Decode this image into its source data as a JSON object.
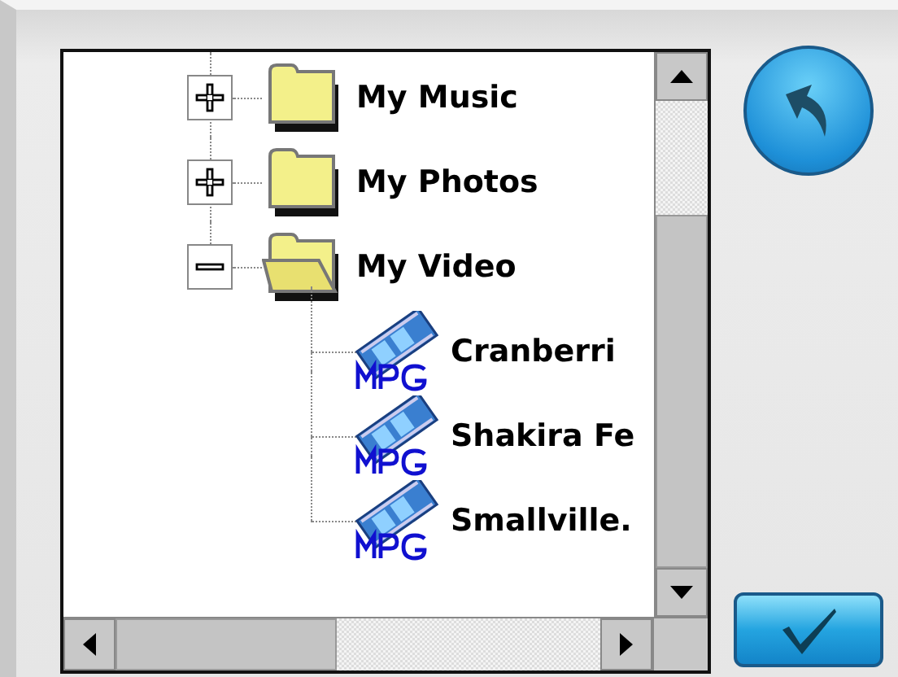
{
  "tree": [
    {
      "kind": "folder",
      "label": "My Music",
      "expanded": false
    },
    {
      "kind": "folder",
      "label": "My Photos",
      "expanded": false
    },
    {
      "kind": "folder",
      "label": "My Video",
      "expanded": true,
      "children": [
        {
          "kind": "video",
          "label": "Cranberri"
        },
        {
          "kind": "video",
          "label": "Shakira Fe"
        },
        {
          "kind": "video",
          "label": "Smallville."
        }
      ]
    }
  ],
  "buttons": [
    {
      "kind": "back"
    },
    {
      "kind": "ok"
    }
  ]
}
